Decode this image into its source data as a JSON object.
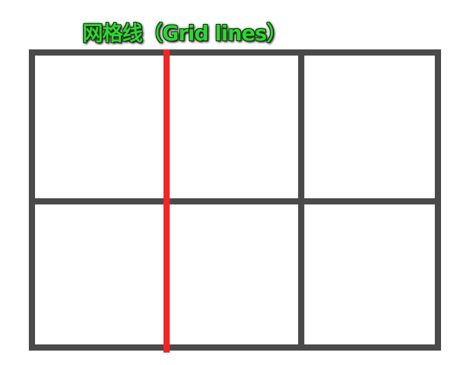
{
  "title": "网格线（Grid lines）",
  "colors": {
    "grid": "#4a4a4a",
    "highlight": "#f42424",
    "title": "#2fd52f"
  },
  "grid": {
    "columns": 3,
    "rows": 2,
    "highlighted_line": "column-line-1"
  }
}
